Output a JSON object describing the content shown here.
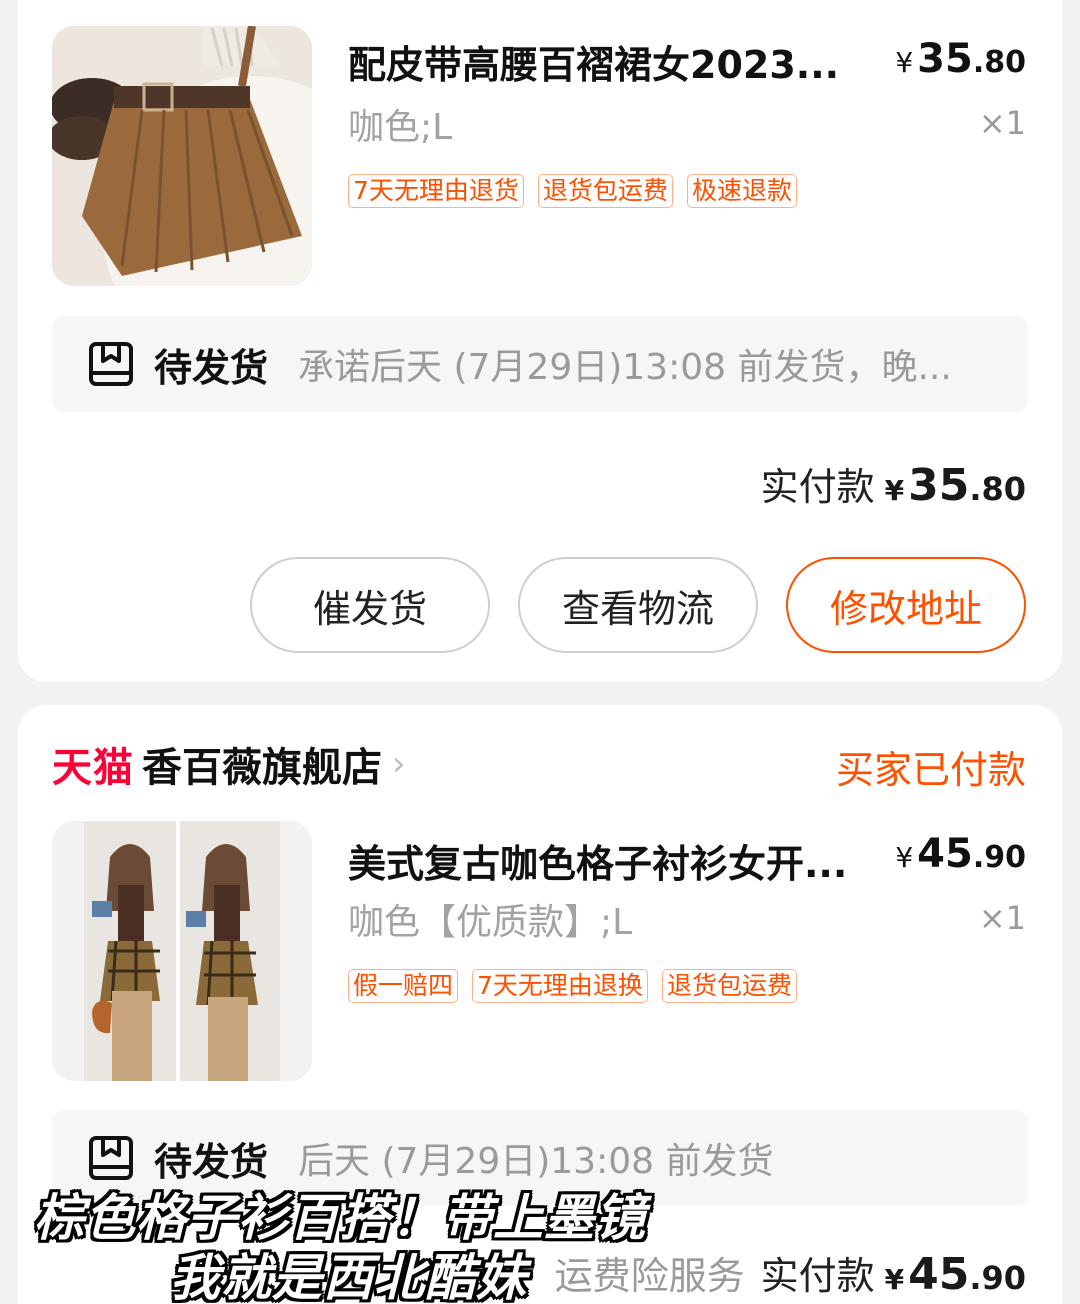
{
  "order1": {
    "item": {
      "title": "配皮带高腰百褶裙女2023...",
      "price_yen": "¥",
      "price_int": "35",
      "price_dec": ".80",
      "spec": "咖色;L",
      "qty": "×1",
      "tags": [
        "7天无理由退货",
        "退货包运费",
        "极速退款"
      ],
      "thumb_icon": "brown-pleated-skirt-image"
    },
    "status": {
      "icon": "package-box-icon",
      "label": "待发货",
      "desc": "承诺后天 (7月29日)13:08 前发货，晚..."
    },
    "paid": {
      "label": "实付款",
      "yen": "¥",
      "int": "35",
      "dec": ".80"
    },
    "buttons": {
      "urge": "催发货",
      "logistics": "查看物流",
      "edit_address": "修改地址"
    }
  },
  "order2": {
    "store": {
      "platform": "天猫",
      "name": "香百薇旗舰店",
      "chevron": "›"
    },
    "order_status": "买家已付款",
    "item": {
      "title": "美式复古咖色格子衬衫女开...",
      "price_yen": "¥",
      "price_int": "45",
      "price_dec": ".90",
      "spec": "咖色【优质款】;L",
      "qty": "×1",
      "tags": [
        "假一赔四",
        "7天无理由退换",
        "退货包运费"
      ],
      "thumb_icon": "model-plaid-shirt-photo"
    },
    "status": {
      "icon": "package-box-icon",
      "label": "待发货",
      "desc": "后天 (7月29日)13:08 前发货"
    },
    "service": "运费险服务",
    "paid": {
      "label": "实付款",
      "yen": "¥",
      "int": "45",
      "dec": ".90"
    }
  },
  "captions": {
    "line1": "棕色格子衫百搭！带上墨镜",
    "line2": "我就是西北酷妹"
  },
  "colors": {
    "accent": "#ff5000",
    "tmall_red": "#ff0036",
    "muted": "#9a9a9a"
  }
}
